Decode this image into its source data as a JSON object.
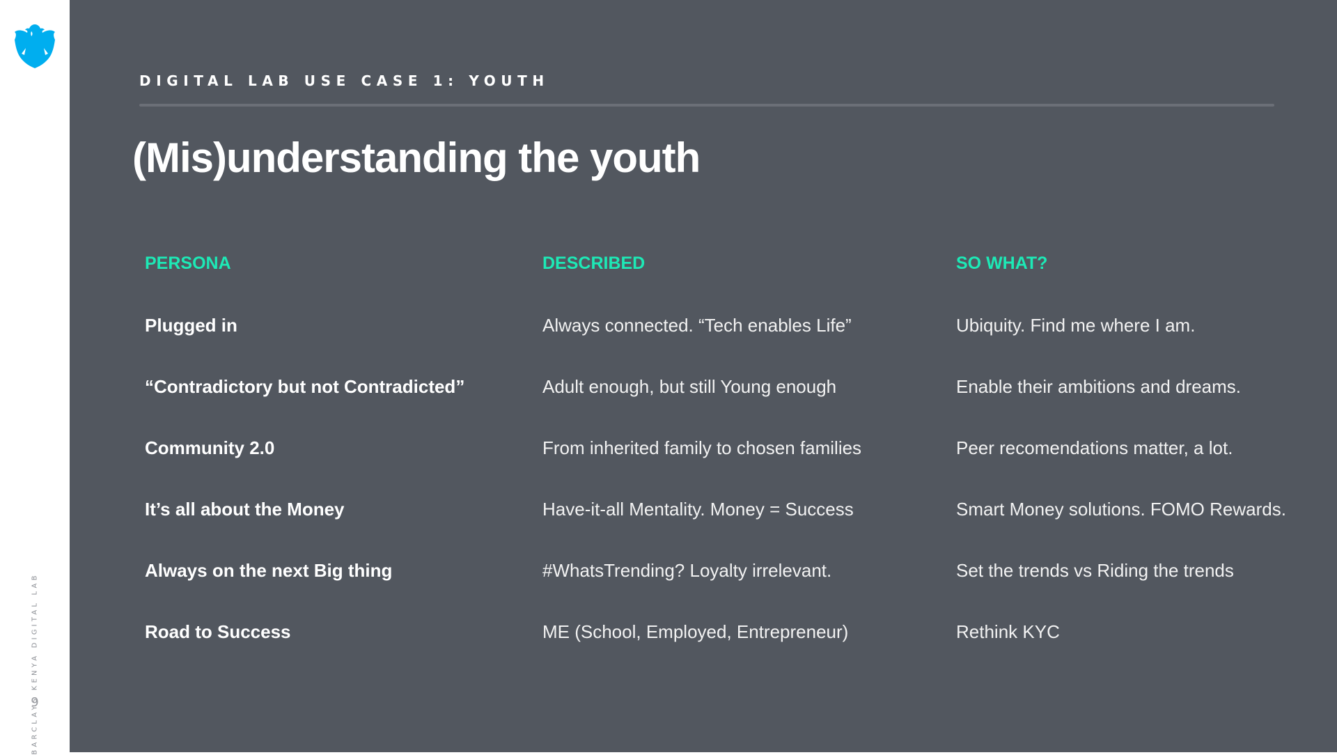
{
  "brand": {
    "logo_icon": "eagle-logo-icon",
    "logo_color": "#00aeef",
    "vertical_label": "BARCLAYS KENYA DIGITAL LAB",
    "page_number": "9"
  },
  "slide": {
    "kicker": "DIGITAL LAB USE CASE 1: YOUTH",
    "title": "(Mis)understanding the youth",
    "accent_color": "#1de9b6",
    "background_color": "#52575f"
  },
  "table": {
    "headers": [
      "PERSONA",
      "DESCRIBED",
      "SO WHAT?"
    ],
    "rows": [
      [
        "Plugged in",
        "Always connected. “Tech enables Life”",
        "Ubiquity. Find me where I am."
      ],
      [
        "“Contradictory but not Contradicted”",
        "Adult enough, but still Young enough",
        "Enable their ambitions and dreams."
      ],
      [
        "Community 2.0",
        "From inherited family to chosen families",
        "Peer recomendations matter, a lot."
      ],
      [
        "It’s all about the Money",
        "Have-it-all Mentality. Money = Success",
        "Smart Money solutions. FOMO Rewards."
      ],
      [
        "Always on the next Big thing",
        "#WhatsTrending? Loyalty irrelevant.",
        "Set the trends vs Riding the trends"
      ],
      [
        "Road to Success",
        "ME (School, Employed, Entrepreneur)",
        "Rethink KYC"
      ]
    ]
  }
}
